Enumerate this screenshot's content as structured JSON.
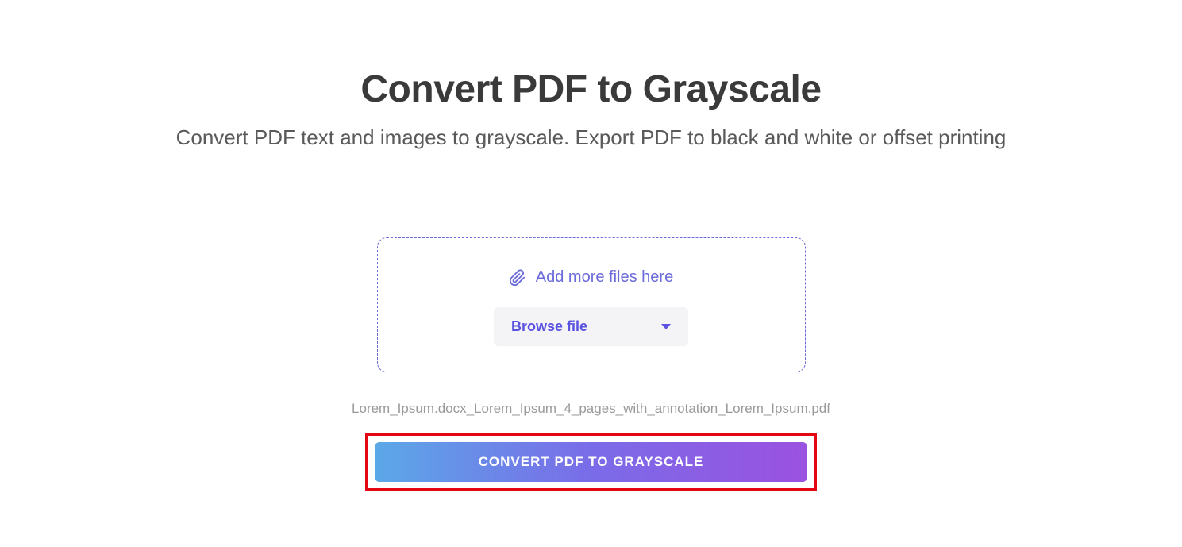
{
  "header": {
    "title": "Convert PDF to Grayscale",
    "subtitle": "Convert PDF text and images to grayscale. Export PDF to black and white or offset printing"
  },
  "dropzone": {
    "hint": "Add more files here",
    "browse_label": "Browse file"
  },
  "uploaded_file": "Lorem_Ipsum.docx_Lorem_Ipsum_4_pages_with_annotation_Lorem_Ipsum.pdf",
  "actions": {
    "convert_label": "CONVERT PDF TO GRAYSCALE"
  }
}
